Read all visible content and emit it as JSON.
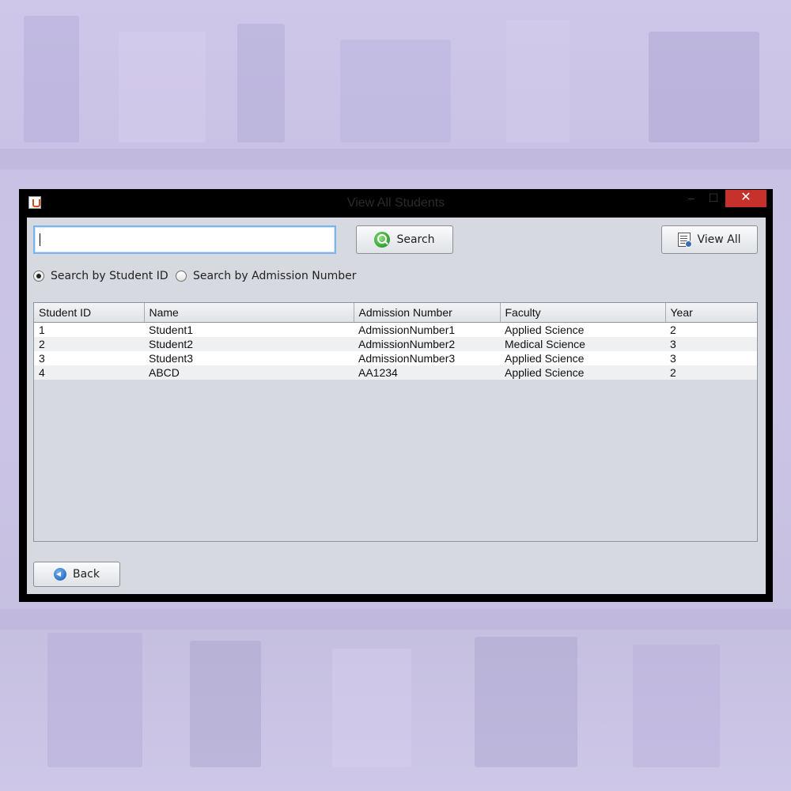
{
  "window": {
    "title": "View All Students",
    "minimize_glyph": "–",
    "maximize_glyph": "☐",
    "close_glyph": "✕"
  },
  "search": {
    "value": "",
    "search_label": "Search",
    "view_all_label": "View All"
  },
  "radios": [
    {
      "label": "Search by Student ID",
      "checked": true
    },
    {
      "label": "Search by Admission Number",
      "checked": false
    }
  ],
  "table": {
    "columns": [
      "Student ID",
      "Name",
      "Admission Number",
      "Faculty",
      "Year"
    ],
    "rows": [
      [
        "1",
        "Student1",
        "AdmissionNumber1",
        "Applied Science",
        "2"
      ],
      [
        "2",
        "Student2",
        "AdmissionNumber2",
        "Medical Science",
        "3"
      ],
      [
        "3",
        "Student3",
        "AdmissionNumber3",
        "Applied Science",
        "3"
      ],
      [
        "4",
        "ABCD",
        "AA1234",
        "Applied Science",
        "2"
      ]
    ]
  },
  "footer": {
    "back_label": "Back"
  },
  "colors": {
    "close_button": "#c7312b",
    "focus_border": "#7eb4ea",
    "panel": "#d6d9df"
  }
}
